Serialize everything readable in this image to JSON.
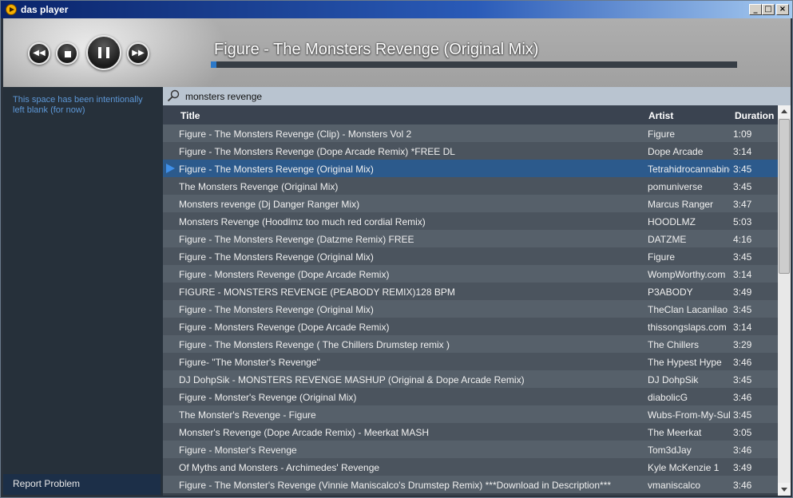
{
  "window": {
    "title": "das player",
    "min": "_",
    "max": "□",
    "close": "×"
  },
  "player": {
    "now_playing": "Figure - The Monsters Revenge (Original Mix)",
    "progress_fraction": 0.01,
    "prev_glyph": "◀◀",
    "next_glyph": "▶▶",
    "icons": {
      "prev": "rewind-icon",
      "stop": "stop-icon",
      "play": "pause-icon",
      "next": "fast-forward-icon"
    }
  },
  "sidebar": {
    "blank_text": "This space has been intentionally left blank (for now)",
    "report_label": "Report Problem"
  },
  "search": {
    "value": "monsters revenge",
    "icon": "search-icon"
  },
  "table": {
    "headers": {
      "title": "Title",
      "artist": "Artist",
      "duration": "Duration"
    },
    "selected_index": 2,
    "rows": [
      {
        "title": "Figure  - The Monsters Revenge (Clip) - Monsters Vol 2",
        "artist": "Figure",
        "duration": "1:09"
      },
      {
        "title": "Figure - The Monsters Revenge (Dope Arcade Remix) *FREE DL",
        "artist": "Dope Arcade",
        "duration": "3:14"
      },
      {
        "title": "Figure - The Monsters Revenge (Original Mix)",
        "artist": "Tetrahidrocannabinol",
        "duration": "3:45"
      },
      {
        "title": "The Monsters Revenge (Original Mix)",
        "artist": "pomuniverse",
        "duration": "3:45"
      },
      {
        "title": "Monsters revenge (Dj Danger Ranger Mix)",
        "artist": "Marcus Ranger",
        "duration": "3:47"
      },
      {
        "title": "Monsters Revenge (Hoodlmz too much red cordial Remix)",
        "artist": "HOODLMZ",
        "duration": "5:03"
      },
      {
        "title": "Figure - The Monsters Revenge (Datzme Remix) FREE",
        "artist": "DATZME",
        "duration": "4:16"
      },
      {
        "title": "Figure - The Monsters Revenge (Original Mix)",
        "artist": "Figure",
        "duration": "3:45"
      },
      {
        "title": "Figure - Monsters Revenge (Dope Arcade Remix)",
        "artist": "WompWorthy.com",
        "duration": "3:14"
      },
      {
        "title": "FIGURE - MONSTERS REVENGE (PEABODY REMIX)128 BPM",
        "artist": "P3ABODY",
        "duration": "3:49"
      },
      {
        "title": "Figure - The Monsters Revenge (Original Mix)",
        "artist": "TheClan Lacanilao",
        "duration": "3:45"
      },
      {
        "title": "Figure - Monsters Revenge (Dope Arcade Remix)",
        "artist": "thissongslaps.com",
        "duration": "3:14"
      },
      {
        "title": "Figure - The Monsters Revenge ( The Chillers Drumstep remix )",
        "artist": "The Chillers",
        "duration": "3:29"
      },
      {
        "title": "Figure- \"The Monster's Revenge\"",
        "artist": "The Hypest Hype",
        "duration": "3:46"
      },
      {
        "title": "DJ DohpSik - MONSTERS REVENGE MASHUP (Original & Dope Arcade Remix)",
        "artist": "DJ DohpSik",
        "duration": "3:45"
      },
      {
        "title": "Figure - Monster's Revenge (Original Mix)",
        "artist": "diabolicG",
        "duration": "3:46"
      },
      {
        "title": "The Monster's Revenge - Figure",
        "artist": "Wubs-From-My-Subs",
        "duration": "3:45"
      },
      {
        "title": "Monster's Revenge (Dope Arcade Remix) - Meerkat MASH",
        "artist": "The Meerkat",
        "duration": "3:05"
      },
      {
        "title": "Figure - Monster's Revenge",
        "artist": "Tom3dJay",
        "duration": "3:46"
      },
      {
        "title": "Of Myths and Monsters - Archimedes' Revenge",
        "artist": "Kyle McKenzie 1",
        "duration": "3:49"
      },
      {
        "title": "Figure - The Monster's Revenge (Vinnie Maniscalco's Drumstep Remix) ***Download in Description***",
        "artist": "vmaniscalco",
        "duration": "3:46"
      }
    ]
  }
}
